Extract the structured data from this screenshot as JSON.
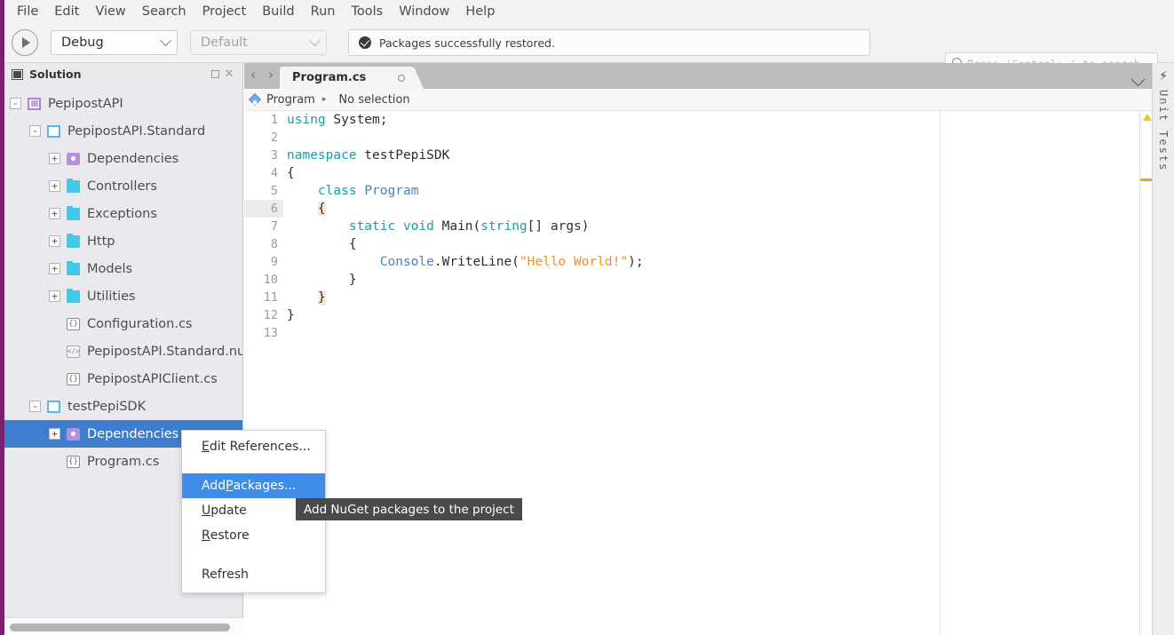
{
  "menubar": {
    "items": [
      "File",
      "Edit",
      "View",
      "Search",
      "Project",
      "Build",
      "Run",
      "Tools",
      "Window",
      "Help"
    ]
  },
  "toolbar": {
    "run_button": "run-play",
    "configuration": "Debug",
    "platform": "Default",
    "status_message": "Packages successfully restored.",
    "search_placeholder": "Press 'Control+,' to search"
  },
  "solution_pad": {
    "title": "Solution",
    "maximize_label": "□",
    "close_label": "×",
    "tree": [
      {
        "label": "PepipostAPI",
        "depth": 0,
        "toggle": "-",
        "icon": "solution-icon",
        "selected": false
      },
      {
        "label": "PepipostAPI.Standard",
        "depth": 1,
        "toggle": "-",
        "icon": "project-icon",
        "selected": false
      },
      {
        "label": "Dependencies",
        "depth": 2,
        "toggle": "+",
        "icon": "dependencies-icon",
        "selected": false
      },
      {
        "label": "Controllers",
        "depth": 2,
        "toggle": "+",
        "icon": "folder-icon",
        "selected": false
      },
      {
        "label": "Exceptions",
        "depth": 2,
        "toggle": "+",
        "icon": "folder-icon",
        "selected": false
      },
      {
        "label": "Http",
        "depth": 2,
        "toggle": "+",
        "icon": "folder-icon",
        "selected": false
      },
      {
        "label": "Models",
        "depth": 2,
        "toggle": "+",
        "icon": "folder-icon",
        "selected": false
      },
      {
        "label": "Utilities",
        "depth": 2,
        "toggle": "+",
        "icon": "folder-icon",
        "selected": false
      },
      {
        "label": "Configuration.cs",
        "depth": 2,
        "toggle": "",
        "icon": "csharp-file-icon",
        "selected": false
      },
      {
        "label": "PepipostAPI.Standard.nuspe",
        "depth": 2,
        "toggle": "",
        "icon": "xml-file-icon",
        "selected": false
      },
      {
        "label": "PepipostAPIClient.cs",
        "depth": 2,
        "toggle": "",
        "icon": "csharp-file-icon",
        "selected": false
      },
      {
        "label": "testPepiSDK",
        "depth": 1,
        "toggle": "-",
        "icon": "project-icon",
        "selected": false
      },
      {
        "label": "Dependencies",
        "depth": 2,
        "toggle": "+",
        "icon": "dependencies-icon",
        "selected": true
      },
      {
        "label": "Program.cs",
        "depth": 2,
        "toggle": "",
        "icon": "csharp-file-icon",
        "selected": false
      }
    ]
  },
  "editor": {
    "nav_back": "‹",
    "nav_forward": "›",
    "tab_title": "Program.cs",
    "tab_modified_indicator": "○",
    "breadcrumb_class": "Program",
    "breadcrumb_separator": "▸",
    "breadcrumb_member": "No selection",
    "lines": [
      {
        "n": "1",
        "tokens": [
          {
            "t": "using",
            "c": "kw"
          },
          {
            "t": " System;",
            "c": ""
          }
        ],
        "gutter_highlight": false
      },
      {
        "n": "2",
        "tokens": [],
        "gutter_highlight": false
      },
      {
        "n": "3",
        "tokens": [
          {
            "t": "namespace",
            "c": "kw"
          },
          {
            "t": " testPepiSDK",
            "c": ""
          }
        ],
        "gutter_highlight": false
      },
      {
        "n": "4",
        "tokens": [
          {
            "t": "{",
            "c": ""
          }
        ],
        "gutter_highlight": false
      },
      {
        "n": "5",
        "tokens": [
          {
            "t": "    ",
            "c": ""
          },
          {
            "t": "class",
            "c": "kw"
          },
          {
            "t": " ",
            "c": ""
          },
          {
            "t": "Program",
            "c": "ty"
          }
        ],
        "gutter_highlight": false
      },
      {
        "n": "6",
        "tokens": [
          {
            "t": "    ",
            "c": ""
          },
          {
            "t": "{",
            "c": "brace-hl"
          }
        ],
        "gutter_highlight": true
      },
      {
        "n": "7",
        "tokens": [
          {
            "t": "        ",
            "c": ""
          },
          {
            "t": "static",
            "c": "kw"
          },
          {
            "t": " ",
            "c": ""
          },
          {
            "t": "void",
            "c": "kw"
          },
          {
            "t": " Main(",
            "c": ""
          },
          {
            "t": "string",
            "c": "kw"
          },
          {
            "t": "[] args)",
            "c": ""
          }
        ],
        "gutter_highlight": false
      },
      {
        "n": "8",
        "tokens": [
          {
            "t": "        {",
            "c": ""
          }
        ],
        "gutter_highlight": false
      },
      {
        "n": "9",
        "tokens": [
          {
            "t": "            ",
            "c": ""
          },
          {
            "t": "Console",
            "c": "ty"
          },
          {
            "t": ".WriteLine(",
            "c": ""
          },
          {
            "t": "\"Hello World!\"",
            "c": "st"
          },
          {
            "t": ");",
            "c": ""
          }
        ],
        "gutter_highlight": false
      },
      {
        "n": "10",
        "tokens": [
          {
            "t": "        }",
            "c": ""
          }
        ],
        "gutter_highlight": false
      },
      {
        "n": "11",
        "tokens": [
          {
            "t": "    ",
            "c": ""
          },
          {
            "t": "}",
            "c": "brace-hl"
          }
        ],
        "gutter_highlight": false
      },
      {
        "n": "12",
        "tokens": [
          {
            "t": "}",
            "c": ""
          }
        ],
        "gutter_highlight": false
      },
      {
        "n": "13",
        "tokens": [],
        "gutter_highlight": false
      }
    ]
  },
  "unit_tests_pad": {
    "label": "Unit Tests",
    "icon": "lightning-bolt-icon"
  },
  "context_menu": {
    "items": [
      {
        "label": "Edit References...",
        "mnemonic": "E",
        "highlight": false,
        "gap_after": true
      },
      {
        "label": "Add Packages...",
        "mnemonic": "P",
        "highlight": true,
        "gap_after": false
      },
      {
        "label": "Update",
        "mnemonic": "U",
        "highlight": false,
        "gap_after": false
      },
      {
        "label": "Restore",
        "mnemonic": "R",
        "highlight": false,
        "gap_after": true
      },
      {
        "label": "Refresh",
        "mnemonic": "",
        "highlight": false,
        "gap_after": false
      }
    ]
  },
  "tooltip": {
    "text": "Add NuGet packages to the project"
  },
  "colors": {
    "accent_strip": "#7b1f6e",
    "selection_blue": "#3d7ecf",
    "menu_highlight": "#3d8ce8",
    "keyword": "#1a9ca8",
    "type": "#4a7fc1",
    "string": "#e8912a",
    "folder": "#41c9e8",
    "dependency": "#b58fe0",
    "warning_marker": "#f5c518",
    "change_marker": "#f0a030"
  }
}
